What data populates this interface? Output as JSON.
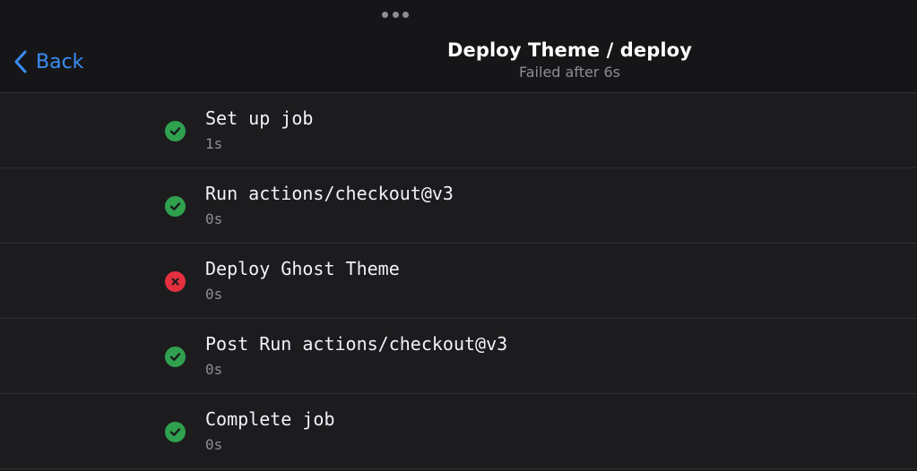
{
  "header": {
    "back_label": "Back",
    "title": "Deploy Theme / deploy",
    "subtitle": "Failed after 6s"
  },
  "colors": {
    "accent": "#3a8ef6",
    "success": "#30a14e",
    "failure": "#e5303f",
    "background": "#1c1c1e"
  },
  "steps": [
    {
      "name": "Set up job",
      "duration": "1s",
      "status": "success",
      "icon": "check-circle-icon"
    },
    {
      "name": "Run actions/checkout@v3",
      "duration": "0s",
      "status": "success",
      "icon": "check-circle-icon"
    },
    {
      "name": "Deploy Ghost Theme",
      "duration": "0s",
      "status": "failure",
      "icon": "x-circle-icon"
    },
    {
      "name": "Post Run actions/checkout@v3",
      "duration": "0s",
      "status": "success",
      "icon": "check-circle-icon"
    },
    {
      "name": "Complete job",
      "duration": "0s",
      "status": "success",
      "icon": "check-circle-icon"
    }
  ]
}
